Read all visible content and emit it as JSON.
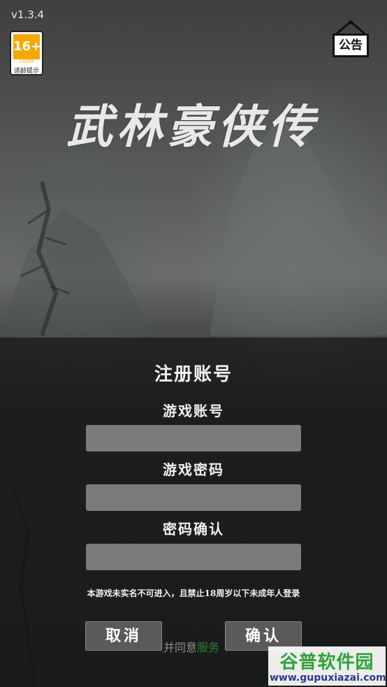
{
  "app": {
    "version": "v1.3.4",
    "title": "武林豪侠传"
  },
  "age_badge": {
    "rating": "16+",
    "org": "CADPA",
    "tip": "适龄提示"
  },
  "notice_button": {
    "label": "公告"
  },
  "register": {
    "title": "注册账号",
    "account_label": "游戏账号",
    "account_value": "",
    "password_label": "游戏密码",
    "password_value": "",
    "confirm_label": "密码确认",
    "confirm_value": "",
    "disclaimer": "本游戏未实名不可进入，且禁止18周岁以下未成年人登录",
    "agree_prefix": "读并同意",
    "agree_link": "服务",
    "cancel_label": "取消",
    "ok_label": "确认"
  },
  "watermark": {
    "brand": "谷普软件园",
    "url": "www.gupuxiazai.com"
  },
  "colors": {
    "badge_orange": "#f5a800",
    "panel_bg": "#161817",
    "field_bg": "#7a7b7a",
    "watermark_green": "#2fa23a"
  }
}
